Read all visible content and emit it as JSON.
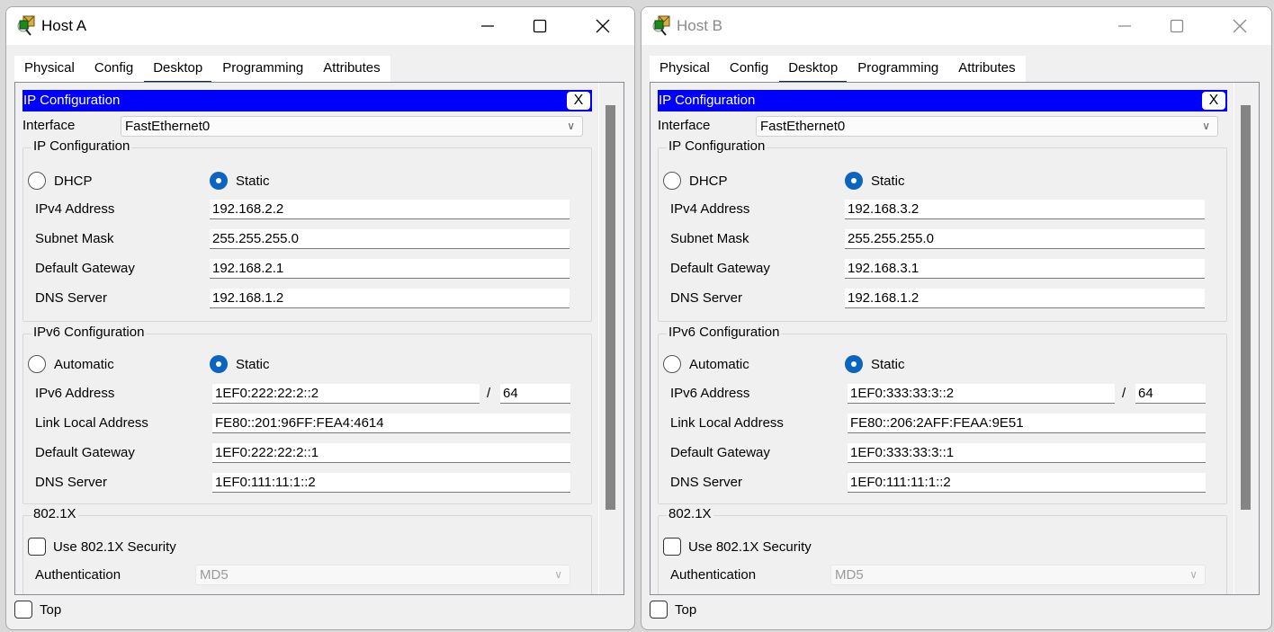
{
  "windows": [
    {
      "title": "Host A",
      "active": true,
      "tabs": [
        {
          "label": "Physical",
          "active": false
        },
        {
          "label": "Config",
          "active": false
        },
        {
          "label": "Desktop",
          "active": true
        },
        {
          "label": "Programming",
          "active": false
        },
        {
          "label": "Attributes",
          "active": false
        }
      ],
      "panel_title": "IP Configuration",
      "panel_close_label": "X",
      "interface_label": "Interface",
      "interface_value": "FastEthernet0",
      "ipv4": {
        "legend": "IP Configuration",
        "dhcp_label": "DHCP",
        "static_label": "Static",
        "mode": "Static",
        "fields": [
          {
            "label": "IPv4 Address",
            "value": "192.168.2.2"
          },
          {
            "label": "Subnet Mask",
            "value": "255.255.255.0"
          },
          {
            "label": "Default Gateway",
            "value": "192.168.2.1"
          },
          {
            "label": "DNS Server",
            "value": "192.168.1.2"
          }
        ]
      },
      "ipv6": {
        "legend": "IPv6 Configuration",
        "auto_label": "Automatic",
        "static_label": "Static",
        "mode": "Static",
        "address_label": "IPv6 Address",
        "address_value": "1EF0:222:22:2::2",
        "prefix_sep": "/",
        "prefix_value": "64",
        "fields": [
          {
            "label": "Link Local Address",
            "value": "FE80::201:96FF:FEA4:4614"
          },
          {
            "label": "Default Gateway",
            "value": "1EF0:222:22:2::1"
          },
          {
            "label": "DNS Server",
            "value": "1EF0:111:11:1::2"
          }
        ]
      },
      "dot1x": {
        "legend": "802.1X",
        "use_security_label": "Use 802.1X Security",
        "use_security_checked": false,
        "auth_label": "Authentication",
        "auth_value": "MD5"
      },
      "top_label": "Top",
      "top_checked": false
    },
    {
      "title": "Host B",
      "active": false,
      "tabs": [
        {
          "label": "Physical",
          "active": false
        },
        {
          "label": "Config",
          "active": false
        },
        {
          "label": "Desktop",
          "active": true
        },
        {
          "label": "Programming",
          "active": false
        },
        {
          "label": "Attributes",
          "active": false
        }
      ],
      "panel_title": "IP Configuration",
      "panel_close_label": "X",
      "interface_label": "Interface",
      "interface_value": "FastEthernet0",
      "ipv4": {
        "legend": "IP Configuration",
        "dhcp_label": "DHCP",
        "static_label": "Static",
        "mode": "Static",
        "fields": [
          {
            "label": "IPv4 Address",
            "value": "192.168.3.2"
          },
          {
            "label": "Subnet Mask",
            "value": "255.255.255.0"
          },
          {
            "label": "Default Gateway",
            "value": "192.168.3.1"
          },
          {
            "label": "DNS Server",
            "value": "192.168.1.2"
          }
        ]
      },
      "ipv6": {
        "legend": "IPv6 Configuration",
        "auto_label": "Automatic",
        "static_label": "Static",
        "mode": "Static",
        "address_label": "IPv6 Address",
        "address_value": "1EF0:333:33:3::2",
        "prefix_sep": "/",
        "prefix_value": "64",
        "fields": [
          {
            "label": "Link Local Address",
            "value": "FE80::206:2AFF:FEAA:9E51"
          },
          {
            "label": "Default Gateway",
            "value": "1EF0:333:33:3::1"
          },
          {
            "label": "DNS Server",
            "value": "1EF0:111:11:1::2"
          }
        ]
      },
      "dot1x": {
        "legend": "802.1X",
        "use_security_label": "Use 802.1X Security",
        "use_security_checked": false,
        "auth_label": "Authentication",
        "auth_value": "MD5"
      },
      "top_label": "Top",
      "top_checked": false
    }
  ],
  "icons": {
    "app": "packet-tracer-pc-icon",
    "minimize": "minimize-icon",
    "maximize": "maximize-icon",
    "close": "close-icon",
    "dropdown": "chevron-down-icon"
  },
  "colors": {
    "panel_title_bg": "#0000ff",
    "radio_selected": "#0a64c0",
    "tab_underline": "#152a50",
    "scrollbar_thumb": "#858585"
  }
}
